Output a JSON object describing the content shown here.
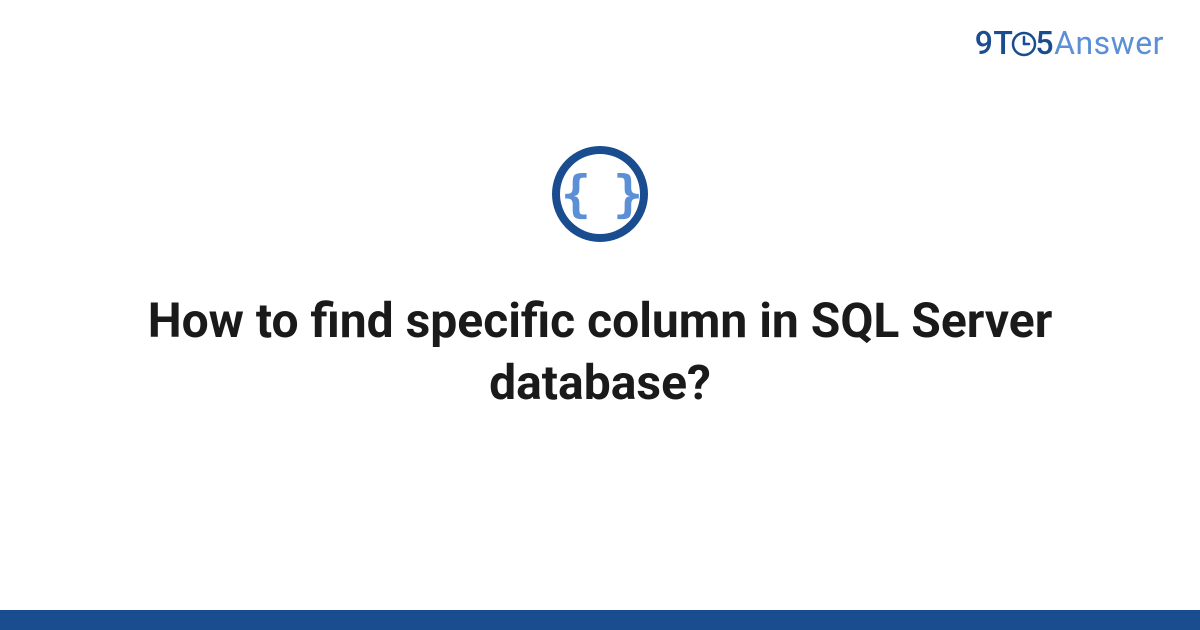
{
  "brand": {
    "part1": "9T",
    "part2": "5",
    "part3": "Answer"
  },
  "icon": {
    "name": "code-braces-icon",
    "glyph": "{ }"
  },
  "question": {
    "title": "How to find specific column in SQL Server database?"
  },
  "colors": {
    "brand_dark": "#1a4d8f",
    "brand_light": "#5b8fd6",
    "text": "#1a1a1a"
  }
}
